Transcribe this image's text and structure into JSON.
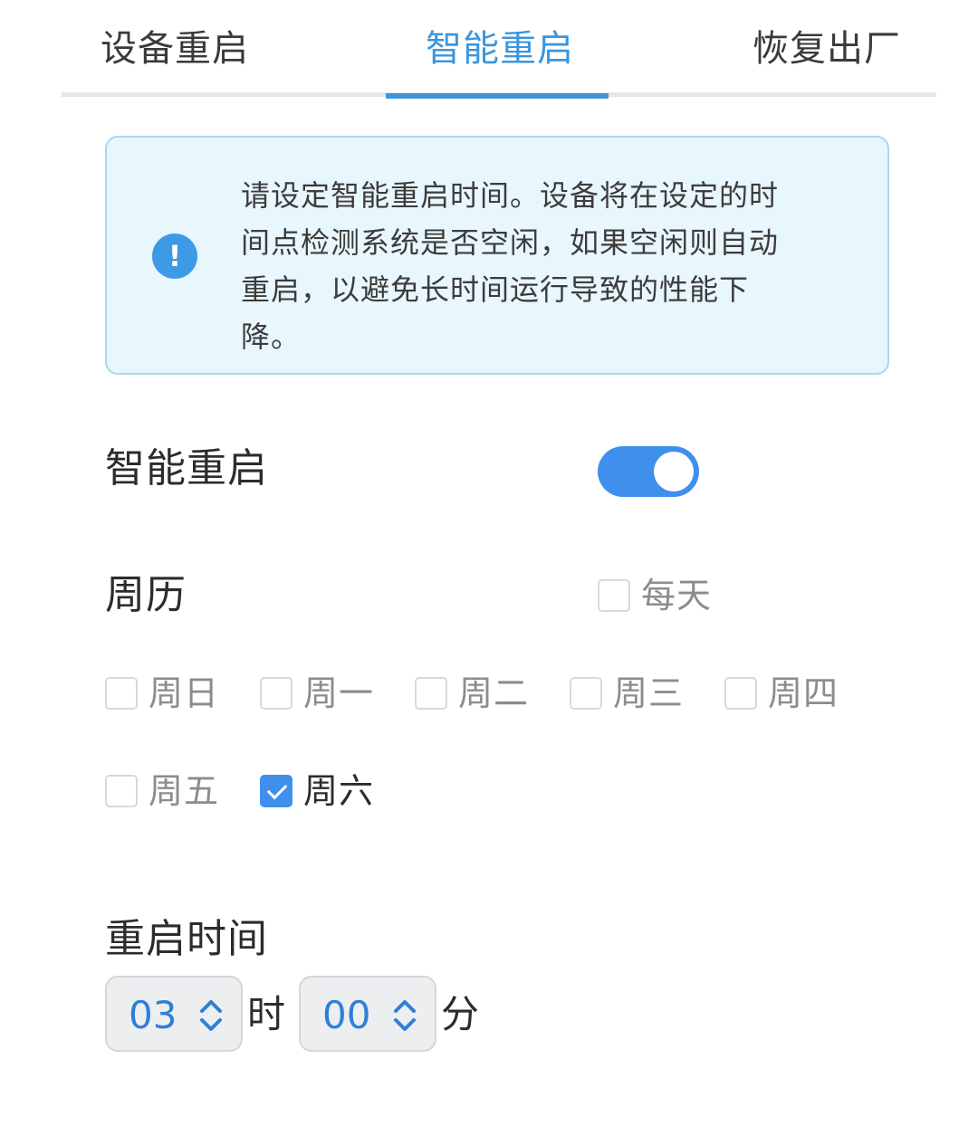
{
  "tabs": [
    {
      "label": "设备重启",
      "active": false
    },
    {
      "label": "智能重启",
      "active": true
    },
    {
      "label": "恢复出厂",
      "active": false
    }
  ],
  "notice": {
    "icon": "info-exclamation-icon",
    "text": "请设定智能重启时间。设备将在设定的时间点检测系统是否空闲，如果空闲则自动重启，以避免长时间运行导致的性能下降。"
  },
  "smart_reboot": {
    "label": "智能重启",
    "enabled": true
  },
  "calendar": {
    "label": "周历",
    "daily": {
      "label": "每天",
      "checked": false
    },
    "days": [
      {
        "label": "周日",
        "checked": false
      },
      {
        "label": "周一",
        "checked": false
      },
      {
        "label": "周二",
        "checked": false
      },
      {
        "label": "周三",
        "checked": false
      },
      {
        "label": "周四",
        "checked": false
      },
      {
        "label": "周五",
        "checked": false
      },
      {
        "label": "周六",
        "checked": true
      }
    ]
  },
  "reboot_time": {
    "label": "重启时间",
    "hour": "03",
    "hour_unit": "时",
    "minute": "00",
    "minute_unit": "分"
  },
  "colors": {
    "accent": "#3b95dc",
    "toggle_on": "#3f8fec",
    "notice_bg": "#e8f6fd",
    "notice_border": "#a9d8ee"
  }
}
